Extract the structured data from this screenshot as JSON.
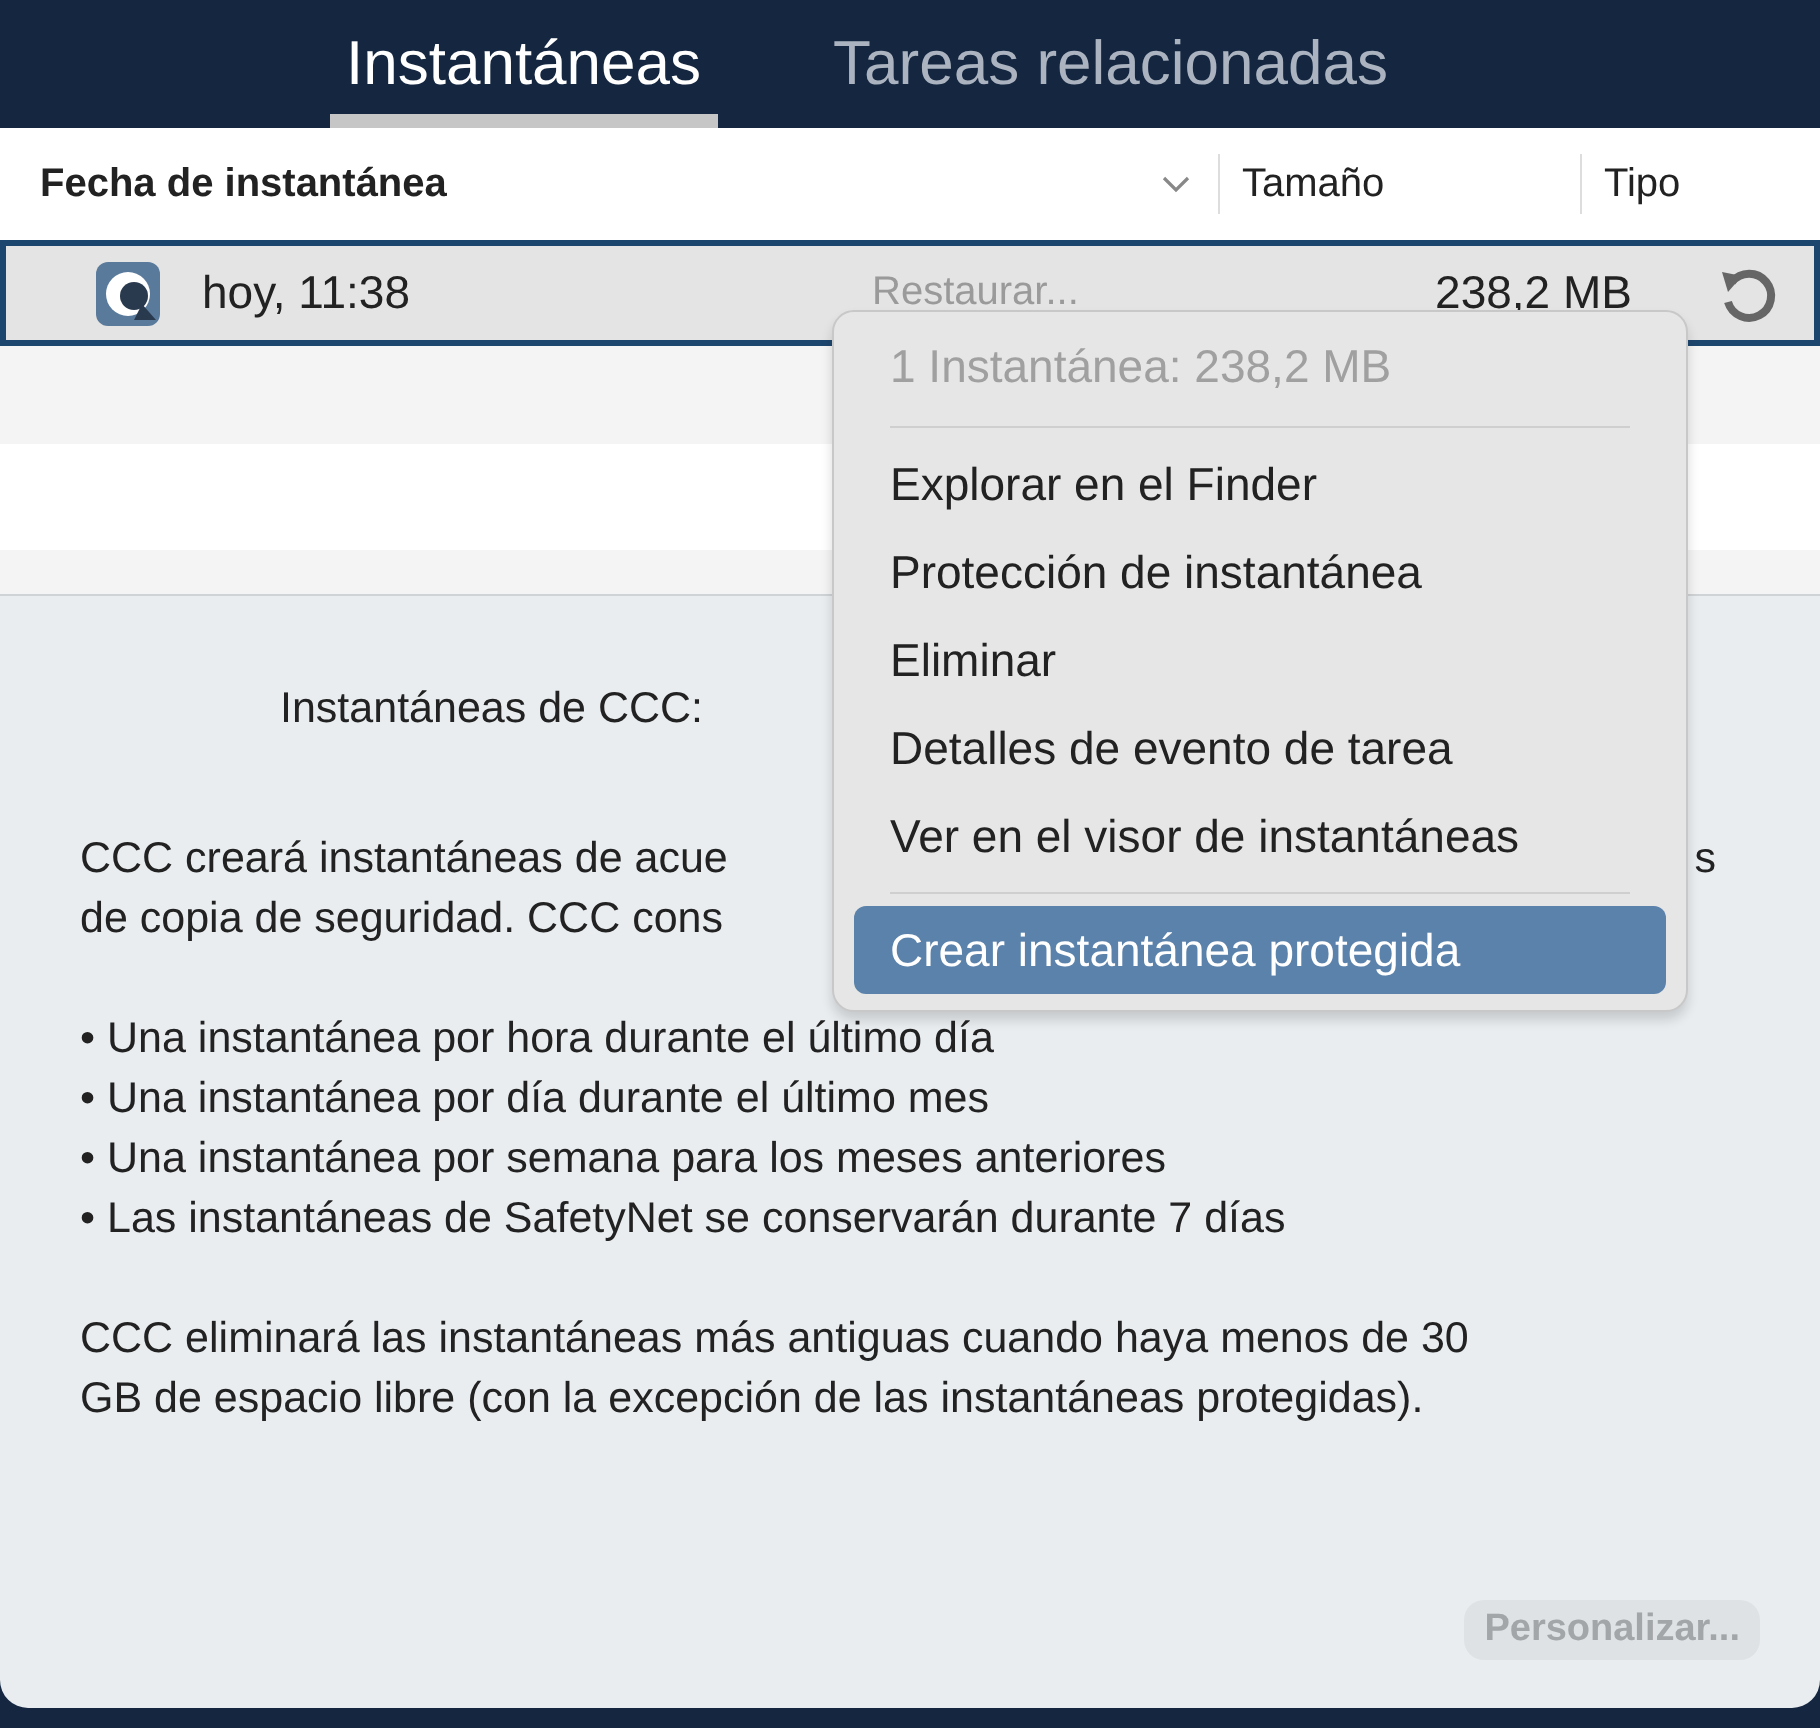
{
  "tabs": [
    {
      "label": "Instantáneas",
      "selected": true
    },
    {
      "label": "Tareas relacionadas",
      "selected": false
    }
  ],
  "table": {
    "columns": [
      "Fecha de instantánea",
      "Tamaño",
      "Tipo"
    ],
    "rows": [
      {
        "date": "hoy, 11:38",
        "action": {
          "label": "Restaurar...",
          "disabled": true
        },
        "size": "238,2 MB",
        "selected": true
      }
    ]
  },
  "context_menu": {
    "header": "1 Instantánea: 238,2 MB",
    "items": [
      {
        "kind": "separator"
      },
      {
        "kind": "item",
        "label": "Explorar en el Finder",
        "selected": false
      },
      {
        "kind": "item",
        "label": "Protección de instantánea",
        "selected": false
      },
      {
        "kind": "item",
        "label": "Eliminar",
        "selected": false
      },
      {
        "kind": "item",
        "label": "Detalles de evento de tarea",
        "selected": false
      },
      {
        "kind": "item",
        "label": "Ver en el visor de instantáneas",
        "selected": false
      },
      {
        "kind": "separator"
      },
      {
        "kind": "item",
        "label": "Crear instantánea protegida",
        "selected": true
      }
    ]
  },
  "panel": {
    "heading": "Instantáneas de CCC:",
    "paragraphs": [
      {
        "lines": [
          [
            "CCC creará instantáneas de acue",
            "s"
          ],
          [
            "de copia de seguridad. CCC cons"
          ]
        ]
      },
      {
        "lines": [
          [
            "• Una instantánea por hora durante el último día"
          ],
          [
            "• Una instantánea por día durante el último mes"
          ],
          [
            "• Una instantánea por semana para los meses anteriores"
          ],
          [
            "• Las instantáneas de SafetyNet se conservarán durante 7 días"
          ]
        ]
      },
      {
        "lines": [
          [
            "CCC eliminará las instantáneas más antiguas cuando haya menos de 30"
          ],
          [
            "GB de espacio libre (con la excepción de las instantáneas protegidas)."
          ]
        ]
      }
    ],
    "button": {
      "label": "Personalizar...",
      "disabled": true
    }
  }
}
